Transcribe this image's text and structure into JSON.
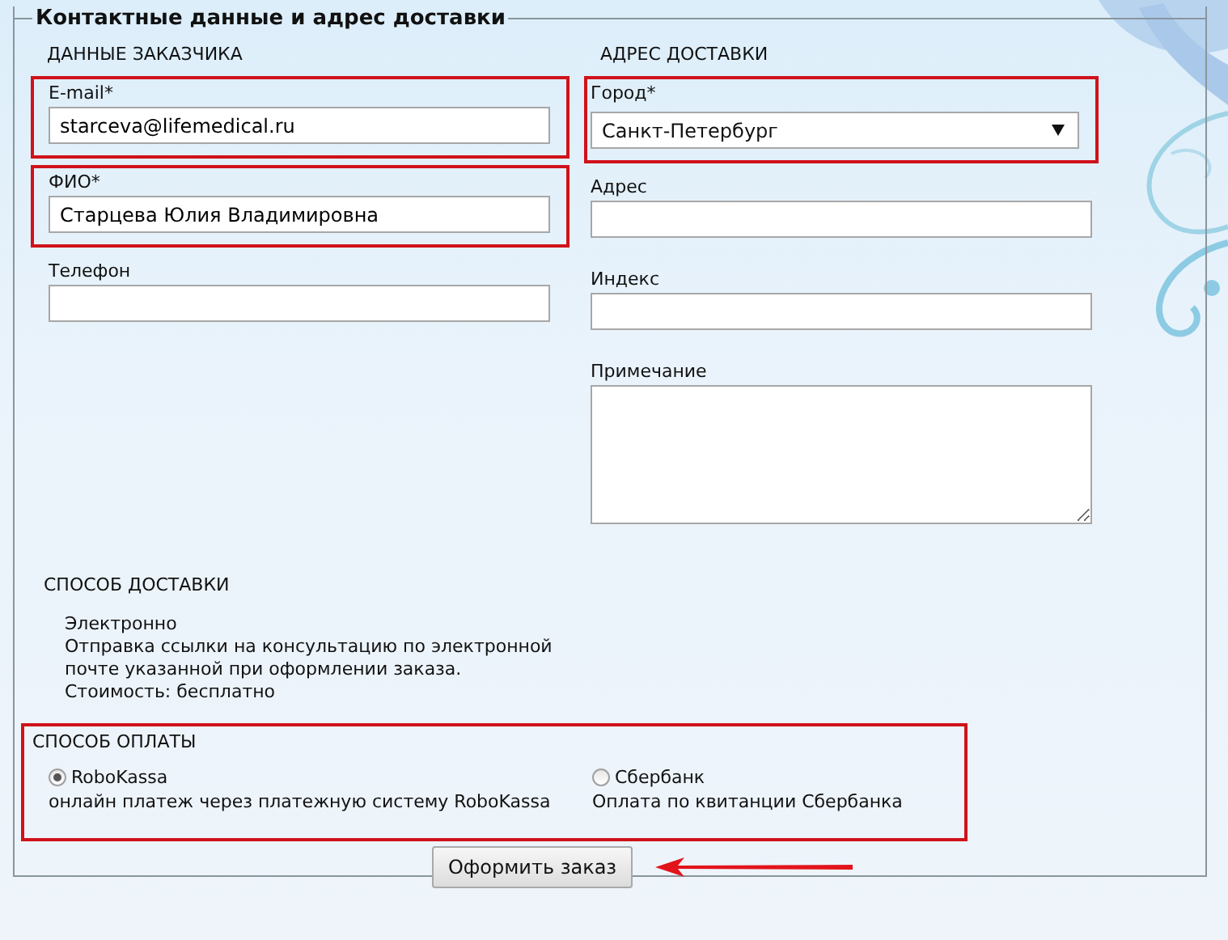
{
  "form": {
    "legend": "Контактные данные и адрес доставки"
  },
  "customer": {
    "heading": "ДАННЫЕ ЗАКАЗЧИКА",
    "fields": [
      {
        "kind": "text",
        "label": "E-mail*",
        "value": "starceva@lifemedical.ru",
        "highlighted": true
      },
      {
        "kind": "text",
        "label": "ФИО*",
        "value": "Старцева Юлия Владимировна",
        "highlighted": true
      },
      {
        "kind": "text",
        "label": "Телефон",
        "highlighted": false
      }
    ]
  },
  "delivery_address": {
    "heading": "АДРЕС ДОСТАВКИ",
    "fields": [
      {
        "kind": "select",
        "label": "Город*",
        "value": "Санкт-Петербург",
        "highlighted": true
      },
      {
        "kind": "text",
        "label": "Адрес",
        "highlighted": false
      },
      {
        "kind": "text",
        "label": "Индекс",
        "highlighted": false
      },
      {
        "kind": "textarea",
        "label": "Примечание",
        "highlighted": false
      }
    ]
  },
  "delivery_method": {
    "heading": "СПОСОБ ДОСТАВКИ",
    "lines": [
      "Электронно",
      "Отправка ссылки на консультацию по электронной",
      "почте указанной при оформлении заказа.",
      "Стоимость: бесплатно"
    ]
  },
  "payment": {
    "heading": "СПОСОБ ОПЛАТЫ",
    "highlighted": true,
    "options": [
      {
        "label": "RoboKassa",
        "description": "онлайн платеж через платежную систему RoboKassa",
        "selected": true
      },
      {
        "label": "Сбербанк",
        "description": "Оплата по квитанции Сбербанка",
        "selected": false
      }
    ]
  },
  "submit": {
    "label": "Оформить заказ",
    "pointer_arrow": true
  }
}
